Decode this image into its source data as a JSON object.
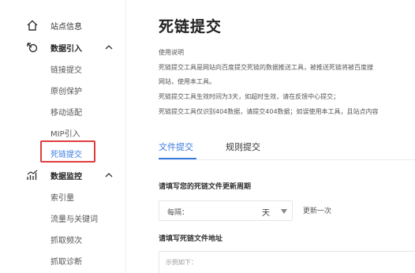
{
  "sidebar": {
    "items": [
      {
        "label": "站点信息",
        "icon": "home-icon",
        "expandable": false
      },
      {
        "label": "数据引入",
        "icon": "data-import-icon",
        "expandable": true,
        "expanded": true,
        "children": [
          "链接提交",
          "原创保护",
          "移动适配",
          "MIP引入",
          "死链提交"
        ]
      },
      {
        "label": "数据监控",
        "icon": "chart-icon",
        "expandable": true,
        "expanded": true,
        "children": [
          "索引量",
          "流量与关键词",
          "抓取频次",
          "抓取诊断"
        ]
      }
    ],
    "active_item": "死链提交"
  },
  "main": {
    "title": "死链提交",
    "description": [
      "使用说明",
      "死链提交工具是网站向百度提交死链的数据推送工具，被推送死链将被百度搜",
      "网站，使用本工具。",
      "死链提交工具生效时间为3天，如超时生效，请在反馈中心提交；",
      "死链提交工具仅识别404数据，请提交404数据；如误使用本工具，且站点内容"
    ],
    "tabs": [
      {
        "label": "文件提交",
        "active": true
      },
      {
        "label": "规则提交",
        "active": false
      }
    ],
    "period_section_label": "请填写您的死链文件更新周期",
    "period_prefix": "每隔：",
    "period_value": "天",
    "period_suffix": "更新一次",
    "address_section_label": "请填写死链文件地址",
    "address_placeholder": "示例如下："
  },
  "colors": {
    "accent": "#3a7be0",
    "highlight_border": "#e03c3c"
  }
}
